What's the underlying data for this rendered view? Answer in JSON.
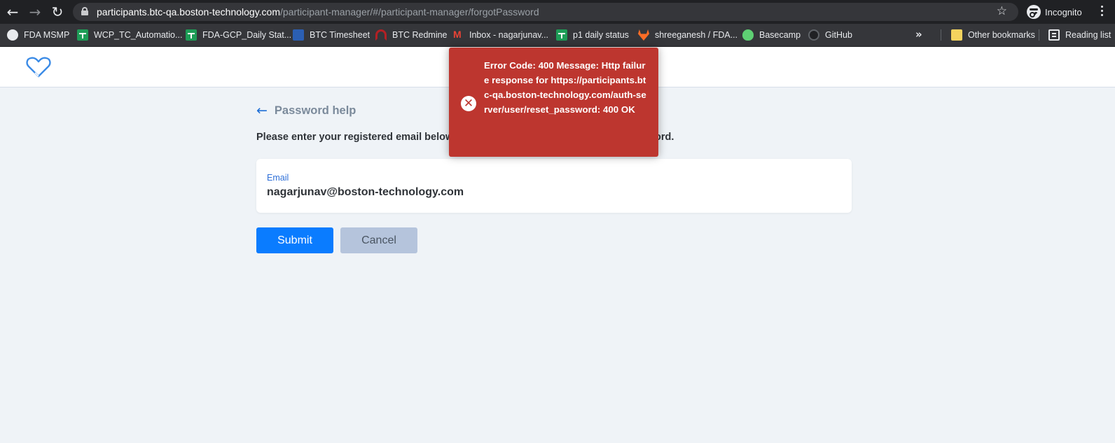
{
  "browser": {
    "url_host": "participants.btc-qa.boston-technology.com",
    "url_path": "/participant-manager/#/participant-manager/forgotPassword",
    "profile_label": "Incognito",
    "bookmarks": [
      {
        "label": "FDA MSMP",
        "icon": "globe-icon"
      },
      {
        "label": "WCP_TC_Automatio...",
        "icon": "sheets-icon"
      },
      {
        "label": "FDA-GCP_Daily Stat...",
        "icon": "sheets-icon"
      },
      {
        "label": "BTC Timesheet",
        "icon": "btc-icon"
      },
      {
        "label": "BTC Redmine",
        "icon": "redmine-icon"
      },
      {
        "label": "Inbox - nagarjunav...",
        "icon": "gmail-icon"
      },
      {
        "label": "p1 daily status",
        "icon": "sheets-icon"
      },
      {
        "label": "shreeganesh / FDA...",
        "icon": "gitlab-icon"
      },
      {
        "label": "Basecamp",
        "icon": "basecamp-icon"
      },
      {
        "label": "GitHub",
        "icon": "github-icon"
      }
    ],
    "overflow_label": "»",
    "other_bookmarks": "Other bookmarks",
    "reading_list": "Reading list"
  },
  "page": {
    "title": "Password help",
    "instruction": "Please enter your registered email below",
    "instruction_tail": "ord.",
    "email_label": "Email",
    "email_value": "nagarjunav@boston-technology.com",
    "submit_label": "Submit",
    "cancel_label": "Cancel"
  },
  "toast": {
    "message": "Error Code: 400 Message: Http failure response for https://participants.btc-qa.boston-technology.com/auth-server/user/reset_password: 400 OK",
    "icon": "error-icon",
    "color": "#bd362f"
  },
  "colors": {
    "primary": "#0a7cff",
    "accent_link": "#1f6fd6",
    "background": "#eff3f7"
  }
}
